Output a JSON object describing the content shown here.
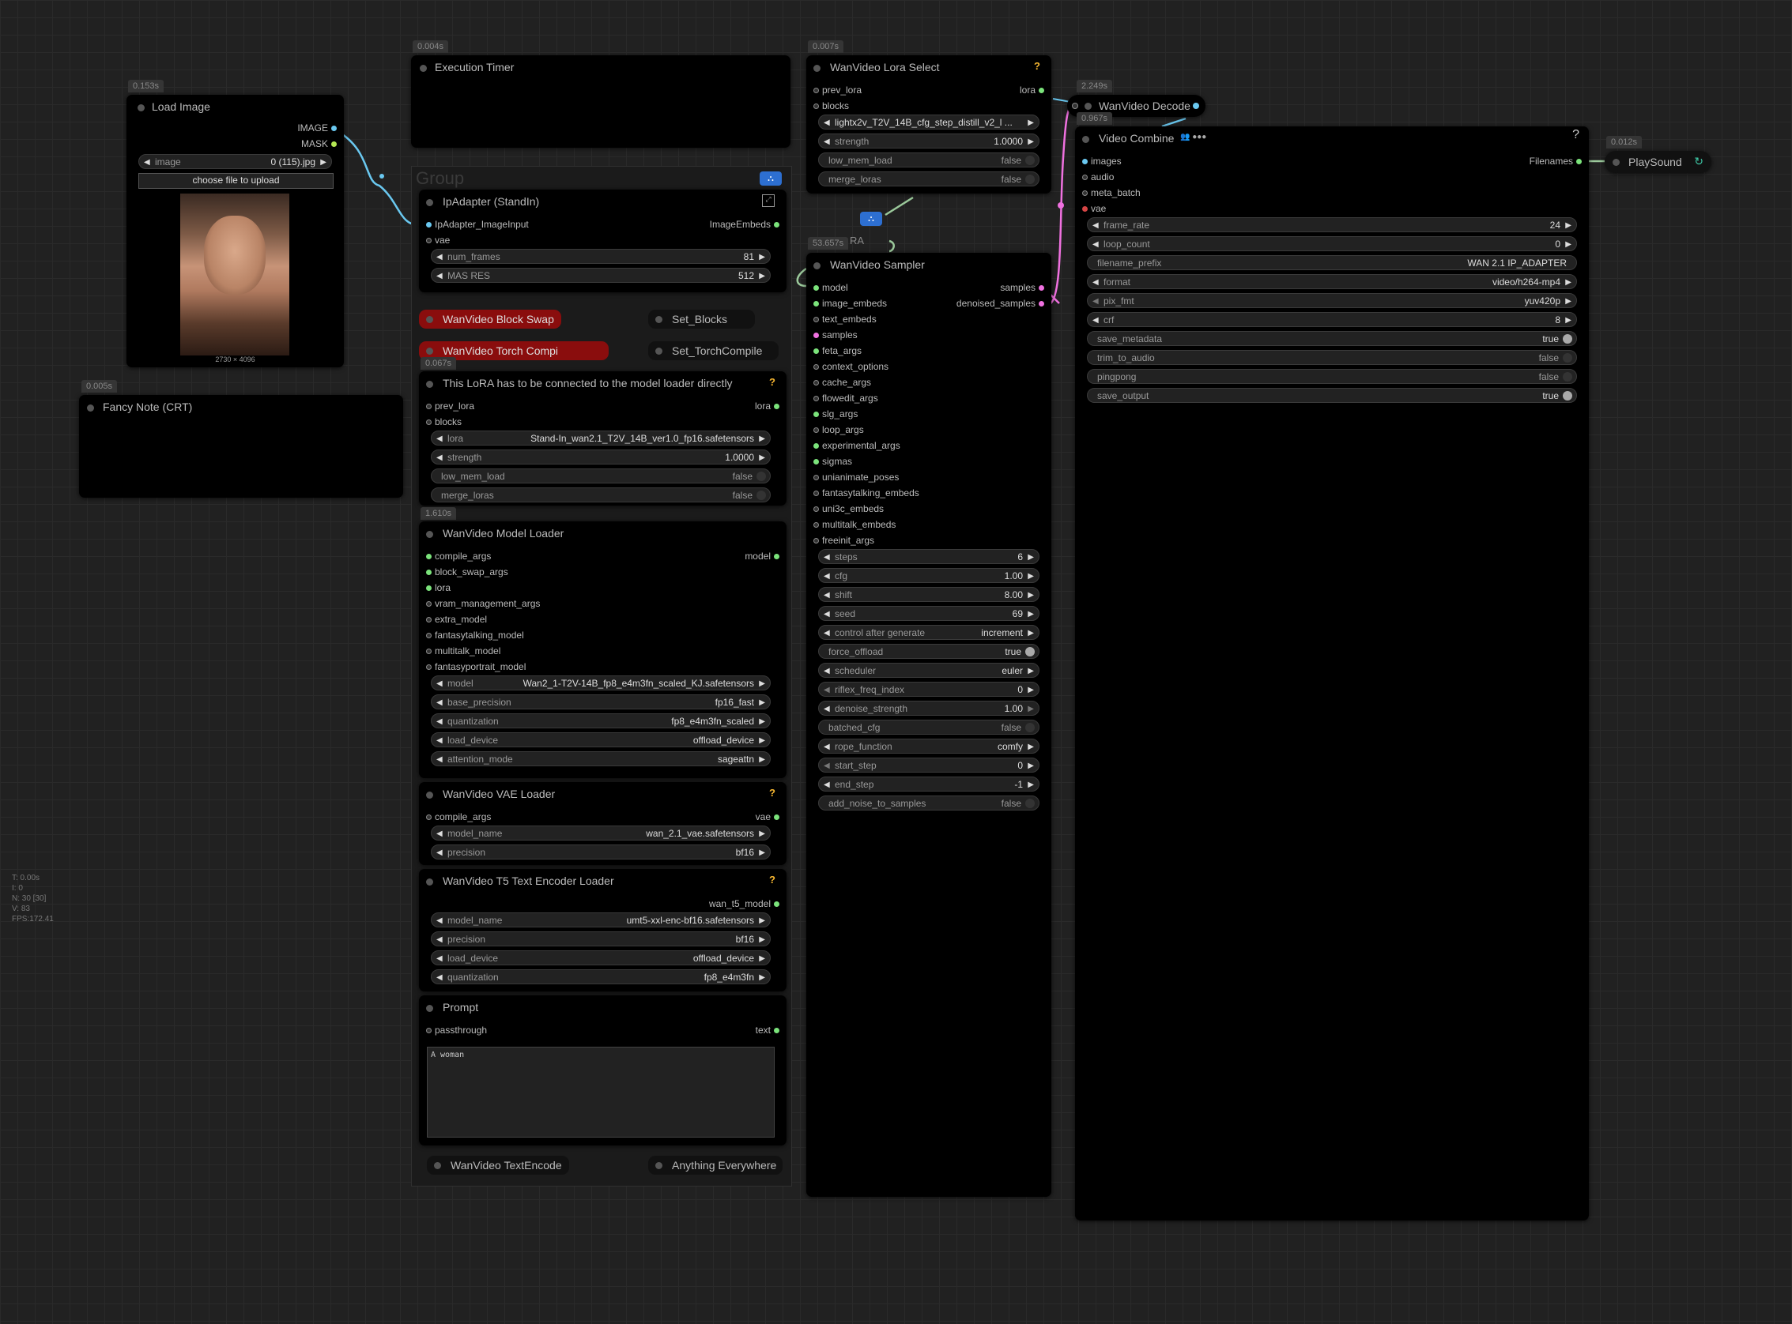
{
  "stats": {
    "t": "T: 0.00s",
    "i": "I: 0",
    "n": "N: 30 [30]",
    "v": "V: 83",
    "fps": "FPS:172.41"
  },
  "group_title": "Group",
  "load_image": {
    "timing": "0.153s",
    "title": "Load Image",
    "outputs": [
      "IMAGE",
      "MASK"
    ],
    "image_label": "image",
    "image_value": "0 (115).jpg",
    "upload_label": "choose file to upload",
    "dims": "2730 × 4096"
  },
  "fancy_note": {
    "timing": "0.005s",
    "title": "Fancy Note (CRT)"
  },
  "execution_timer": {
    "timing": "0.004s",
    "title": "Execution Timer"
  },
  "ipadapter": {
    "title": "IpAdapter (StandIn)",
    "inputs": [
      "IpAdapter_ImageInput",
      "vae"
    ],
    "output": "ImageEmbeds",
    "widgets": [
      {
        "label": "num_frames",
        "value": "81"
      },
      {
        "label": "MAS RES",
        "value": "512"
      }
    ]
  },
  "block_swap": {
    "title": "WanVideo Block Swap",
    "set": "Set_Blocks"
  },
  "torch_compile": {
    "title": "WanVideo Torch Compi",
    "set": "Set_TorchCompile"
  },
  "lora_node": {
    "timing": "0.067s",
    "title": "This LoRA has to be connected to the model loader directly",
    "inputs": [
      "prev_lora",
      "blocks"
    ],
    "output": "lora",
    "widgets": [
      {
        "label": "lora",
        "value": "Stand-In_wan2.1_T2V_14B_ver1.0_fp16.safetensors"
      },
      {
        "label": "strength",
        "value": "1.0000"
      },
      {
        "label": "low_mem_load",
        "value": "false"
      },
      {
        "label": "merge_loras",
        "value": "false"
      }
    ]
  },
  "model_loader": {
    "timing": "1.610s",
    "title": "WanVideo Model Loader",
    "inputs": [
      "compile_args",
      "block_swap_args",
      "lora",
      "vram_management_args",
      "extra_model",
      "fantasytalking_model",
      "multitalk_model",
      "fantasyportrait_model"
    ],
    "output": "model",
    "widgets": [
      {
        "label": "model",
        "value": "Wan2_1-T2V-14B_fp8_e4m3fn_scaled_KJ.safetensors"
      },
      {
        "label": "base_precision",
        "value": "fp16_fast"
      },
      {
        "label": "quantization",
        "value": "fp8_e4m3fn_scaled"
      },
      {
        "label": "load_device",
        "value": "offload_device"
      },
      {
        "label": "attention_mode",
        "value": "sageattn"
      }
    ]
  },
  "vae_loader": {
    "title": "WanVideo VAE Loader",
    "input": "compile_args",
    "output": "vae",
    "widgets": [
      {
        "label": "model_name",
        "value": "wan_2.1_vae.safetensors"
      },
      {
        "label": "precision",
        "value": "bf16"
      }
    ]
  },
  "t5_loader": {
    "title": "WanVideo T5 Text Encoder Loader",
    "output": "wan_t5_model",
    "widgets": [
      {
        "label": "model_name",
        "value": "umt5-xxl-enc-bf16.safetensors"
      },
      {
        "label": "precision",
        "value": "bf16"
      },
      {
        "label": "load_device",
        "value": "offload_device"
      },
      {
        "label": "quantization",
        "value": "fp8_e4m3fn"
      }
    ]
  },
  "prompt": {
    "title": "Prompt",
    "input": "passthrough",
    "output": "text",
    "text": "A woman"
  },
  "text_encode": {
    "title": "WanVideo TextEncode",
    "set": "Anything Everywhere"
  },
  "lora_select": {
    "timing": "0.007s",
    "title": "WanVideo Lora Select",
    "inputs": [
      "prev_lora",
      "blocks"
    ],
    "output": "lora",
    "widgets": [
      {
        "label": "",
        "value": "lightx2v_T2V_14B_cfg_step_distill_v2_l ..."
      },
      {
        "label": "strength",
        "value": "1.0000"
      },
      {
        "label": "low_mem_load",
        "value": "false"
      },
      {
        "label": "merge_loras",
        "value": "false"
      }
    ]
  },
  "sampler": {
    "timing": "53.657s",
    "partial_label": "RA",
    "title": "WanVideo Sampler",
    "inputs": [
      "model",
      "image_embeds",
      "text_embeds",
      "samples",
      "feta_args",
      "context_options",
      "cache_args",
      "flowedit_args",
      "slg_args",
      "loop_args",
      "experimental_args",
      "sigmas",
      "unianimate_poses",
      "fantasytalking_embeds",
      "uni3c_embeds",
      "multitalk_embeds",
      "freeinit_args"
    ],
    "outputs": [
      "samples",
      "denoised_samples"
    ],
    "widgets": [
      {
        "label": "steps",
        "value": "6"
      },
      {
        "label": "cfg",
        "value": "1.00"
      },
      {
        "label": "shift",
        "value": "8.00"
      },
      {
        "label": "seed",
        "value": "69"
      },
      {
        "label": "control after generate",
        "value": "increment"
      },
      {
        "label": "force_offload",
        "value": "true"
      },
      {
        "label": "scheduler",
        "value": "euler"
      },
      {
        "label": "riflex_freq_index",
        "value": "0"
      },
      {
        "label": "denoise_strength",
        "value": "1.00"
      },
      {
        "label": "batched_cfg",
        "value": "false"
      },
      {
        "label": "rope_function",
        "value": "comfy"
      },
      {
        "label": "start_step",
        "value": "0"
      },
      {
        "label": "end_step",
        "value": "-1"
      },
      {
        "label": "add_noise_to_samples",
        "value": "false"
      }
    ]
  },
  "decode": {
    "timing": "2.249s",
    "title": "WanVideo Decode"
  },
  "video_combine": {
    "timing": "0.967s",
    "title": "Video Combine",
    "inputs": [
      "images",
      "audio",
      "meta_batch",
      "vae"
    ],
    "output": "Filenames",
    "widgets": [
      {
        "label": "frame_rate",
        "value": "24"
      },
      {
        "label": "loop_count",
        "value": "0"
      },
      {
        "label": "filename_prefix",
        "value": "WAN 2.1 IP_ADAPTER"
      },
      {
        "label": "format",
        "value": "video/h264-mp4"
      },
      {
        "label": "pix_fmt",
        "value": "yuv420p"
      },
      {
        "label": "crf",
        "value": "8"
      },
      {
        "label": "save_metadata",
        "value": "true"
      },
      {
        "label": "trim_to_audio",
        "value": "false"
      },
      {
        "label": "pingpong",
        "value": "false"
      },
      {
        "label": "save_output",
        "value": "true"
      }
    ]
  },
  "playsound": {
    "timing": "0.012s",
    "title": "PlaySound"
  }
}
